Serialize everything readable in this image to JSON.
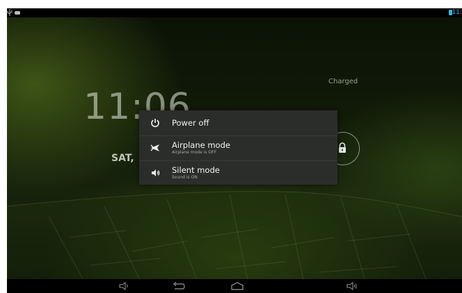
{
  "status_bar": {
    "time": "11:",
    "icons": [
      "usb-icon",
      "notification-icon",
      "battery-icon"
    ],
    "accent_color": "#33b5e5"
  },
  "lockscreen": {
    "charge_status": "Charged",
    "clock": "11:06",
    "date": "SAT,",
    "icons": [
      "lock-icon"
    ]
  },
  "power_menu": {
    "items": [
      {
        "title": "Power off",
        "subtitle": "",
        "icon": "power-icon"
      },
      {
        "title": "Airplane mode",
        "subtitle": "Airplane mode is OFF",
        "icon": "airplane-icon"
      },
      {
        "title": "Silent mode",
        "subtitle": "Sound is ON",
        "icon": "volume-icon"
      }
    ],
    "background_color": "#2b2d2b"
  },
  "nav_bar": {
    "icons": [
      "volume-down-icon",
      "back-icon",
      "home-icon",
      "volume-up-icon"
    ]
  }
}
